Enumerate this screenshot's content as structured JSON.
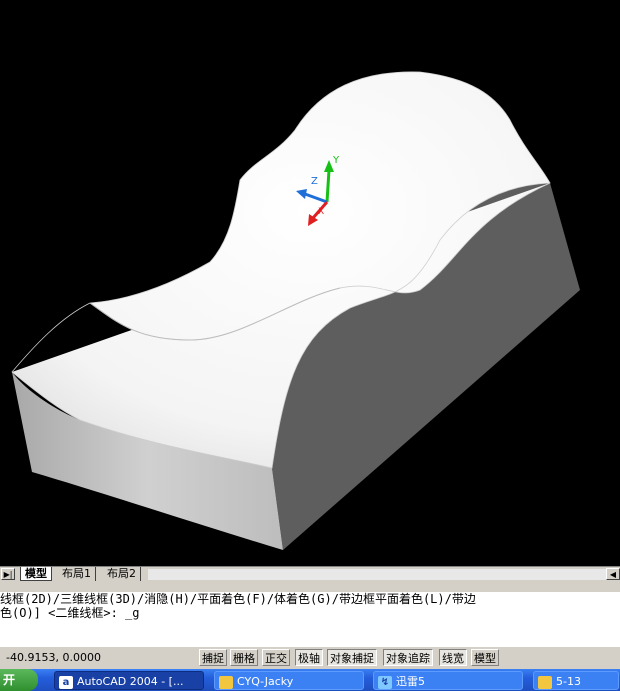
{
  "layout_tabs": {
    "nav_first": "▶|",
    "items": [
      "模型",
      "布局1",
      "布局2"
    ]
  },
  "command": {
    "line1": "线框(2D)/三维线框(3D)/消隐(H)/平面着色(F)/体着色(G)/带边框平面着色(L)/带边",
    "line2": "色(O)] <二维线框>: _g"
  },
  "status": {
    "coords": "-40.9153, 0.0000",
    "toggles": [
      "捕捉",
      "栅格",
      "正交",
      "极轴",
      "对象捕捉",
      "对象追踪",
      "线宽",
      "模型"
    ]
  },
  "ucs": {
    "y": "Y",
    "z": "Z",
    "x": "X"
  },
  "taskbar": {
    "start": "开",
    "tasks": [
      {
        "label": "AutoCAD 2004 - [...",
        "icon": "autocad-icon"
      },
      {
        "label": "CYQ-Jacky",
        "icon": "folder-icon"
      },
      {
        "label": "迅雷5",
        "icon": "thunder-icon"
      },
      {
        "label": "5-13",
        "icon": "folder-icon"
      }
    ]
  },
  "colors": {
    "viewport_bg": "#000000",
    "solid_top": "#ffffff",
    "solid_side_dark": "#5e5e5e",
    "solid_side_light": "#c8c8c8",
    "ucs_y": "#16c016",
    "ucs_z": "#1e6fd8",
    "ucs_x": "#e02020",
    "taskbar": "#245edb"
  }
}
